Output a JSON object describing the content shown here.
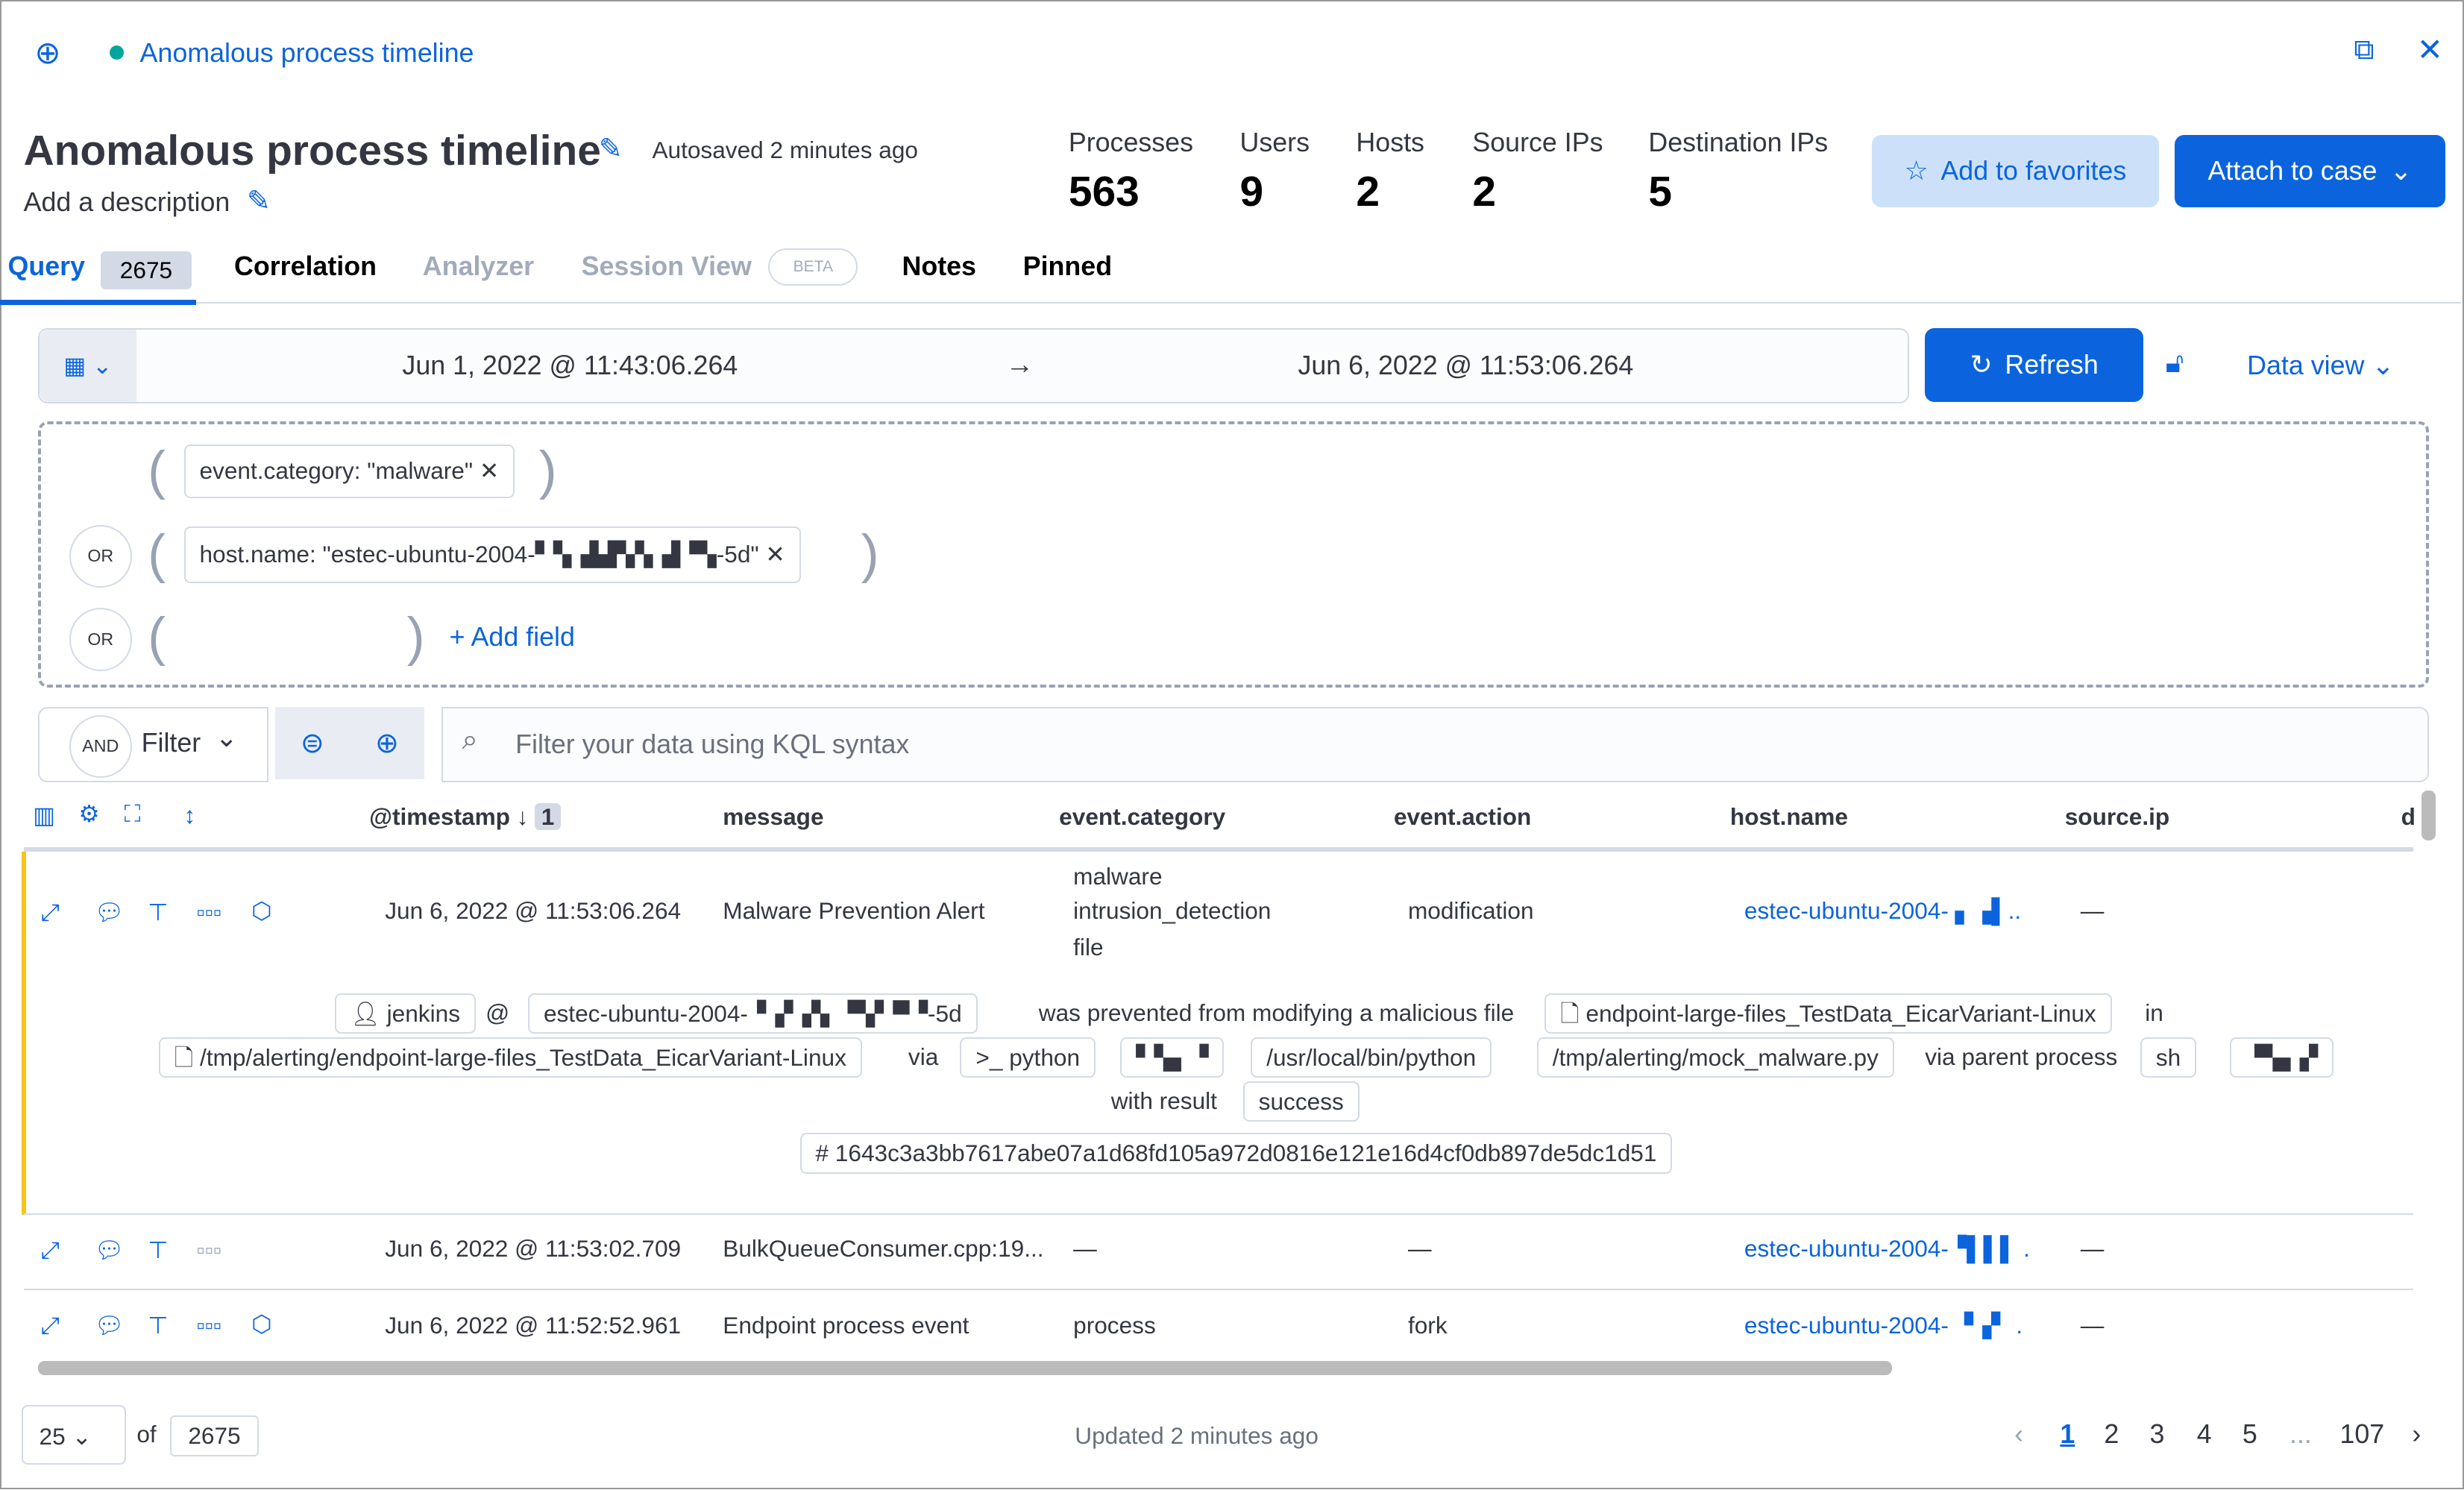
{
  "header": {
    "breadcrumb_title": "Anomalous process timeline",
    "title": "Anomalous process timeline",
    "autosaved": "Autosaved 2 minutes ago",
    "description": "Add a description",
    "status_color": "#00a69b"
  },
  "stats": [
    {
      "label": "Processes",
      "value": "563"
    },
    {
      "label": "Users",
      "value": "9"
    },
    {
      "label": "Hosts",
      "value": "2"
    },
    {
      "label": "Source IPs",
      "value": "2"
    },
    {
      "label": "Destination IPs",
      "value": "5"
    }
  ],
  "actions": {
    "favorites": "Add to favorites",
    "attach": "Attach to case"
  },
  "tabs": [
    {
      "label": "Query",
      "count": "2675"
    },
    {
      "label": "Correlation"
    },
    {
      "label": "Analyzer"
    },
    {
      "label": "Session View",
      "badge": "BETA"
    },
    {
      "label": "Notes"
    },
    {
      "label": "Pinned"
    }
  ],
  "datepicker": {
    "start": "Jun 1, 2022 @ 11:43:06.264",
    "end": "Jun 6, 2022 @ 11:53:06.264",
    "refresh": "Refresh",
    "data_view": "Data view"
  },
  "dataproviders": {
    "group1": "event.category: \"malware\"",
    "group2": "host.name: \"estec-ubuntu-2004-▘▚▗▙▛▞▖▟▝▚-5d\"",
    "or": "OR",
    "add_field": "+ Add field"
  },
  "filterbar": {
    "and": "AND",
    "filter": "Filter",
    "placeholder": "Filter your data using KQL syntax"
  },
  "table": {
    "columns": [
      "@timestamp",
      "message",
      "event.category",
      "event.action",
      "host.name",
      "source.ip",
      "d"
    ],
    "sort_count": "1",
    "rows": [
      {
        "timestamp": "Jun 6, 2022 @ 11:53:06.264",
        "message": "Malware Prevention Alert",
        "category": [
          "malware",
          "intrusion_detection",
          "file"
        ],
        "action": "modification",
        "host": "estec-ubuntu-2004- ▖▗▌..",
        "source_ip": "—"
      },
      {
        "timestamp": "Jun 6, 2022 @ 11:53:02.709",
        "message": "BulkQueueConsumer.cpp:19...",
        "category": [
          "—"
        ],
        "action": "—",
        "host": "estec-ubuntu-2004-▝▌▌▌ .",
        "source_ip": "—"
      },
      {
        "timestamp": "Jun 6, 2022 @ 11:52:52.961",
        "message": "Endpoint process event",
        "category": [
          "process"
        ],
        "action": "fork",
        "host": "estec-ubuntu-2004- ▝▗▘ .",
        "source_ip": "—"
      }
    ],
    "renderer": {
      "user": "jenkins",
      "at": "@",
      "host": "estec-ubuntu-2004-▝▗▘▞▖▝▚▘▀▝-5d",
      "prevented": "was prevented from modifying a malicious file",
      "file": "endpoint-large-files_TestData_EicarVariant-Linux",
      "in": "in",
      "path": "/tmp/alerting/endpoint-large-files_TestData_EicarVariant-Linux",
      "via": "via",
      "process": ">_ python",
      "pid": "▘▚▖▝",
      "exe": "/usr/local/bin/python",
      "args": "/tmp/alerting/mock_malware.py",
      "via_parent": "via parent process",
      "parent": "sh",
      "ppid": "▝▚▖▞",
      "with_result": "with result",
      "result": "success",
      "hash": "# 1643c3a3bb7617abe07a1d68fd105a972d0816e121e16d4cf0db897de5dc1d51"
    }
  },
  "footer": {
    "per_page": "25",
    "of": "of",
    "total": "2675",
    "updated": "Updated 2 minutes ago",
    "pages": [
      "1",
      "2",
      "3",
      "4",
      "5",
      "...",
      "107"
    ]
  },
  "colors": {
    "accent": "#0b64dd",
    "row_highlight": "#f5c518"
  }
}
